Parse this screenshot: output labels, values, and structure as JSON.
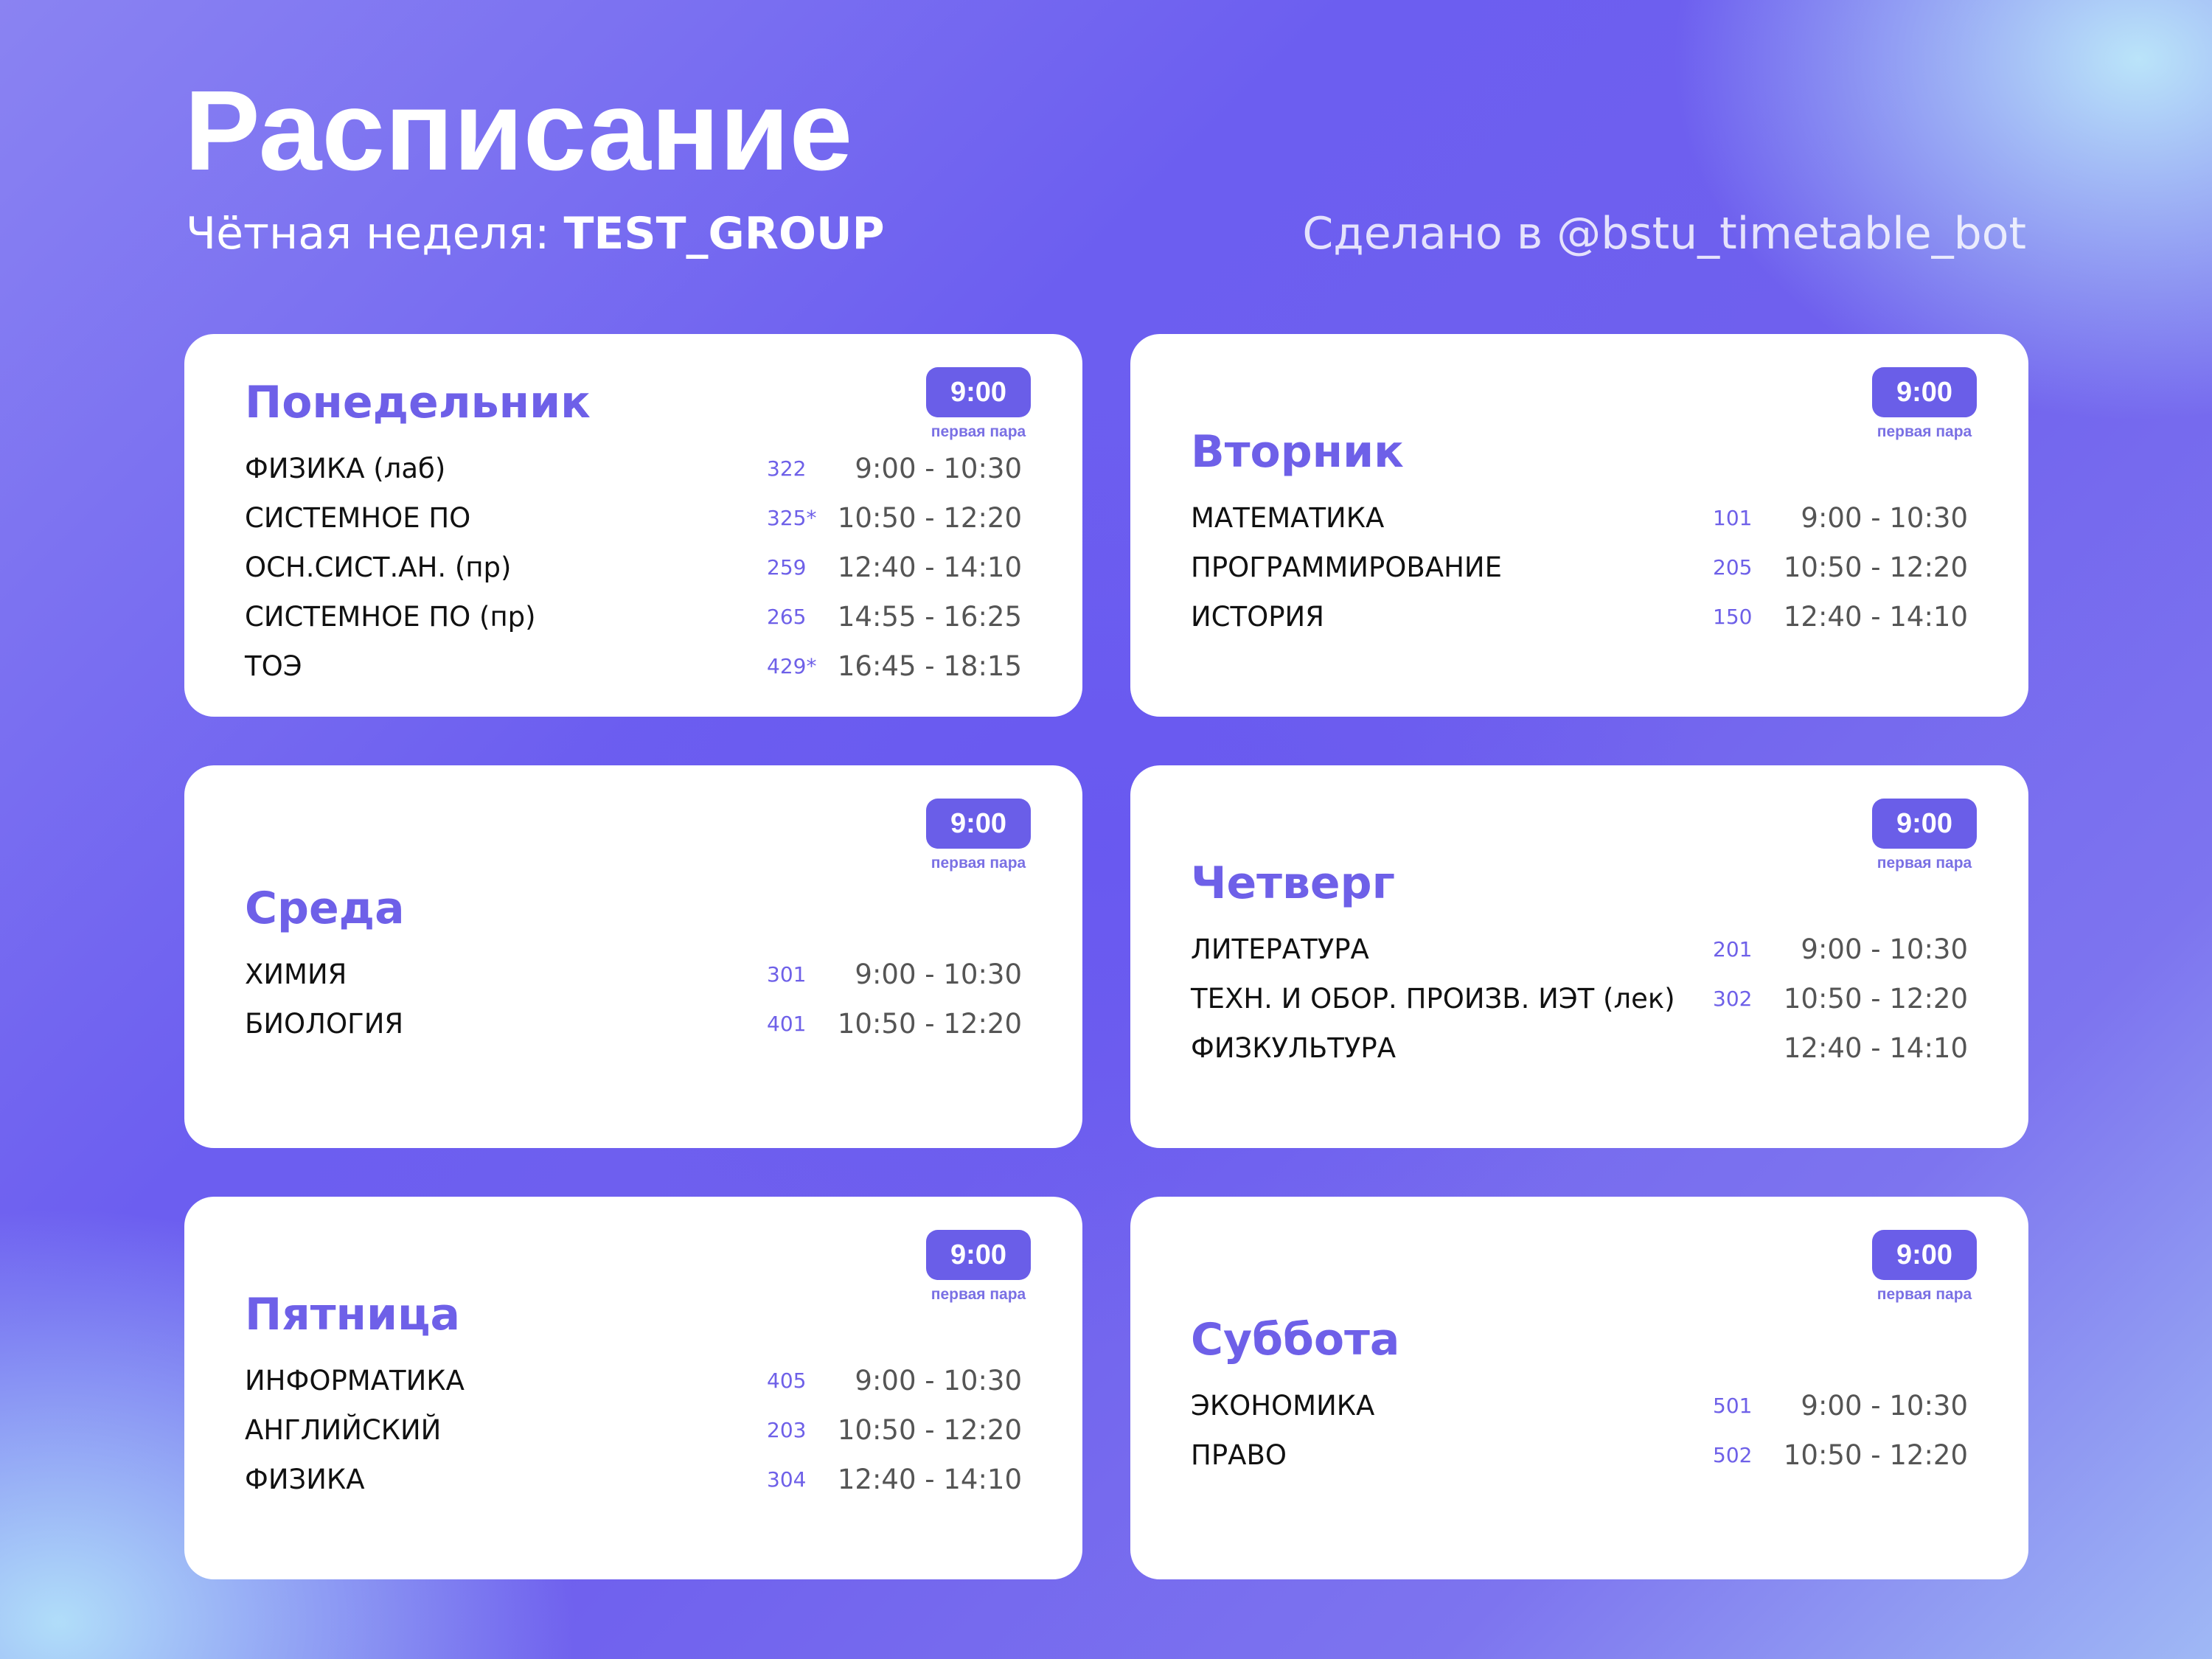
{
  "header": {
    "title": "Расписание",
    "week_label": "Чётная неделя: ",
    "group": "TEST_GROUP",
    "credit": "Сделано в @bstu_timetable_bot"
  },
  "colors": {
    "accent": "#6a5ee8",
    "card_background": "#ffffff",
    "subject_text": "#111111",
    "time_text": "#555555"
  },
  "days": [
    {
      "name": "Понедельник",
      "badge_time": "9:00",
      "badge_note": "первая пара",
      "lessons": [
        {
          "subject": "ФИЗИКА (лаб)",
          "room": "322",
          "time": "9:00 - 10:30"
        },
        {
          "subject": "СИСТЕМНОЕ ПО",
          "room": "325*",
          "time": "10:50 - 12:20"
        },
        {
          "subject": "ОСН.СИСТ.АН. (пр)",
          "room": "259",
          "time": "12:40 - 14:10"
        },
        {
          "subject": "СИСТЕМНОЕ ПО (пр)",
          "room": "265",
          "time": "14:55 - 16:25"
        },
        {
          "subject": "ТОЭ",
          "room": "429*",
          "time": "16:45 - 18:15"
        }
      ]
    },
    {
      "name": "Вторник",
      "badge_time": "9:00",
      "badge_note": "первая пара",
      "lessons": [
        {
          "subject": "МАТЕМАТИКА",
          "room": "101",
          "time": "9:00 - 10:30"
        },
        {
          "subject": "ПРОГРАММИРОВАНИЕ",
          "room": "205",
          "time": "10:50 - 12:20"
        },
        {
          "subject": "ИСТОРИЯ",
          "room": "150",
          "time": "12:40 - 14:10"
        }
      ]
    },
    {
      "name": "Среда",
      "badge_time": "9:00",
      "badge_note": "первая пара",
      "lessons": [
        {
          "subject": "ХИМИЯ",
          "room": "301",
          "time": "9:00 - 10:30"
        },
        {
          "subject": "БИОЛОГИЯ",
          "room": "401",
          "time": "10:50 - 12:20"
        }
      ]
    },
    {
      "name": "Четверг",
      "badge_time": "9:00",
      "badge_note": "первая пара",
      "lessons": [
        {
          "subject": "ЛИТЕРАТУРА",
          "room": "201",
          "time": "9:00 - 10:30"
        },
        {
          "subject": "ТЕХН. И ОБОР. ПРОИЗВ. ИЭТ (лек)",
          "room": "302",
          "time": "10:50 - 12:20"
        },
        {
          "subject": "ФИЗКУЛЬТУРА",
          "room": "",
          "time": "12:40 - 14:10"
        }
      ]
    },
    {
      "name": "Пятница",
      "badge_time": "9:00",
      "badge_note": "первая пара",
      "lessons": [
        {
          "subject": "ИНФОРМАТИКА",
          "room": "405",
          "time": "9:00 - 10:30"
        },
        {
          "subject": "АНГЛИЙСКИЙ",
          "room": "203",
          "time": "10:50 - 12:20"
        },
        {
          "subject": "ФИЗИКА",
          "room": "304",
          "time": "12:40 - 14:10"
        }
      ]
    },
    {
      "name": "Суббота",
      "badge_time": "9:00",
      "badge_note": "первая пара",
      "lessons": [
        {
          "subject": "ЭКОНОМИКА",
          "room": "501",
          "time": "9:00 - 10:30"
        },
        {
          "subject": "ПРАВО",
          "room": "502",
          "time": "10:50 - 12:20"
        }
      ]
    }
  ]
}
